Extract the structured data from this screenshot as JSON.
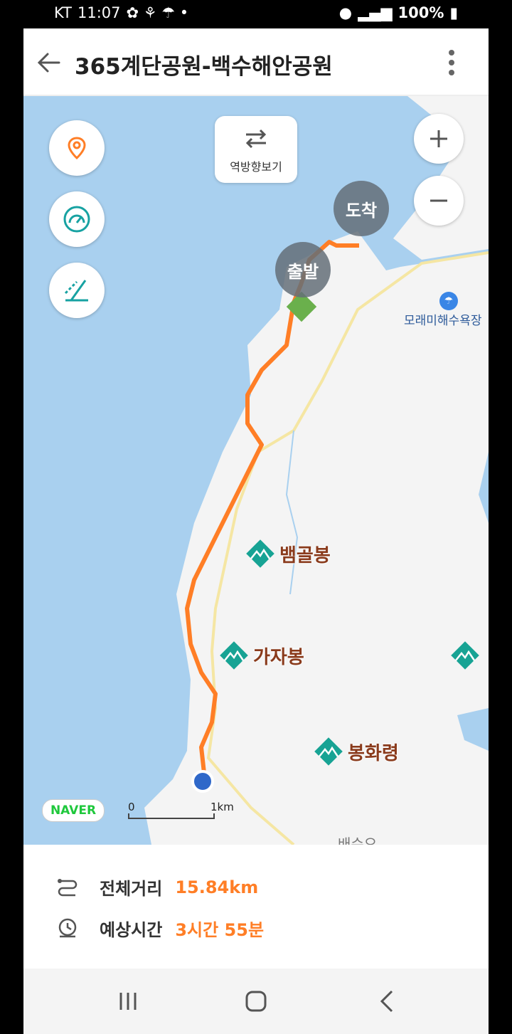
{
  "status_bar": {
    "carrier": "KT",
    "time": "11:07",
    "battery": "100%",
    "icons": [
      "notification-icon",
      "location-icon",
      "wifi-icon",
      "hd-icon",
      "signal-icon",
      "battery-icon"
    ]
  },
  "header": {
    "title": "365계단공원-백수해안공원",
    "back_icon": "arrow-left-icon",
    "menu_icon": "more-vertical-icon"
  },
  "map": {
    "controls": [
      {
        "name": "location-pin-button",
        "icon": "location-pin-icon"
      },
      {
        "name": "speed-button",
        "icon": "speedometer-icon"
      },
      {
        "name": "slope-button",
        "icon": "slope-icon"
      }
    ],
    "reverse_label": "역방향보기",
    "start_label": "출발",
    "end_label": "도착",
    "beach_label": "모래미해수욕장",
    "peaks": [
      {
        "name": "뱀골봉"
      },
      {
        "name": "가자봉"
      },
      {
        "name": "봉화령"
      }
    ],
    "naver_logo": "NAVER",
    "scale_start": "0",
    "scale_end": "1km",
    "partial_label": "배수오",
    "accent_color": "#ff7e26"
  },
  "summary": {
    "distance_label": "전체거리",
    "distance_value": "15.84km",
    "time_label": "예상시간",
    "time_value": "3시간 55분"
  },
  "nav_bar": {
    "buttons": [
      "recents-icon",
      "home-icon",
      "back-icon"
    ]
  }
}
